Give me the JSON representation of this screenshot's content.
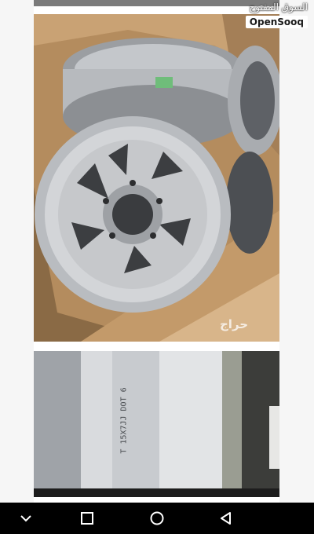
{
  "branding": {
    "arabic_label": "السوق المفتوح",
    "english_label": "OpenSooq"
  },
  "photos": {
    "wheels_watermark": "حراج",
    "closeup_stamp": "T 15X7JJ DOT 6"
  },
  "navigation": {
    "back_icon": "chevron-down-icon",
    "recents_icon": "square-icon",
    "home_icon": "circle-icon",
    "back_triangle_icon": "triangle-back-icon"
  },
  "colors": {
    "navbar": "#000000",
    "cardboard": "#b98a5a",
    "wheel": "#c9cbce"
  }
}
